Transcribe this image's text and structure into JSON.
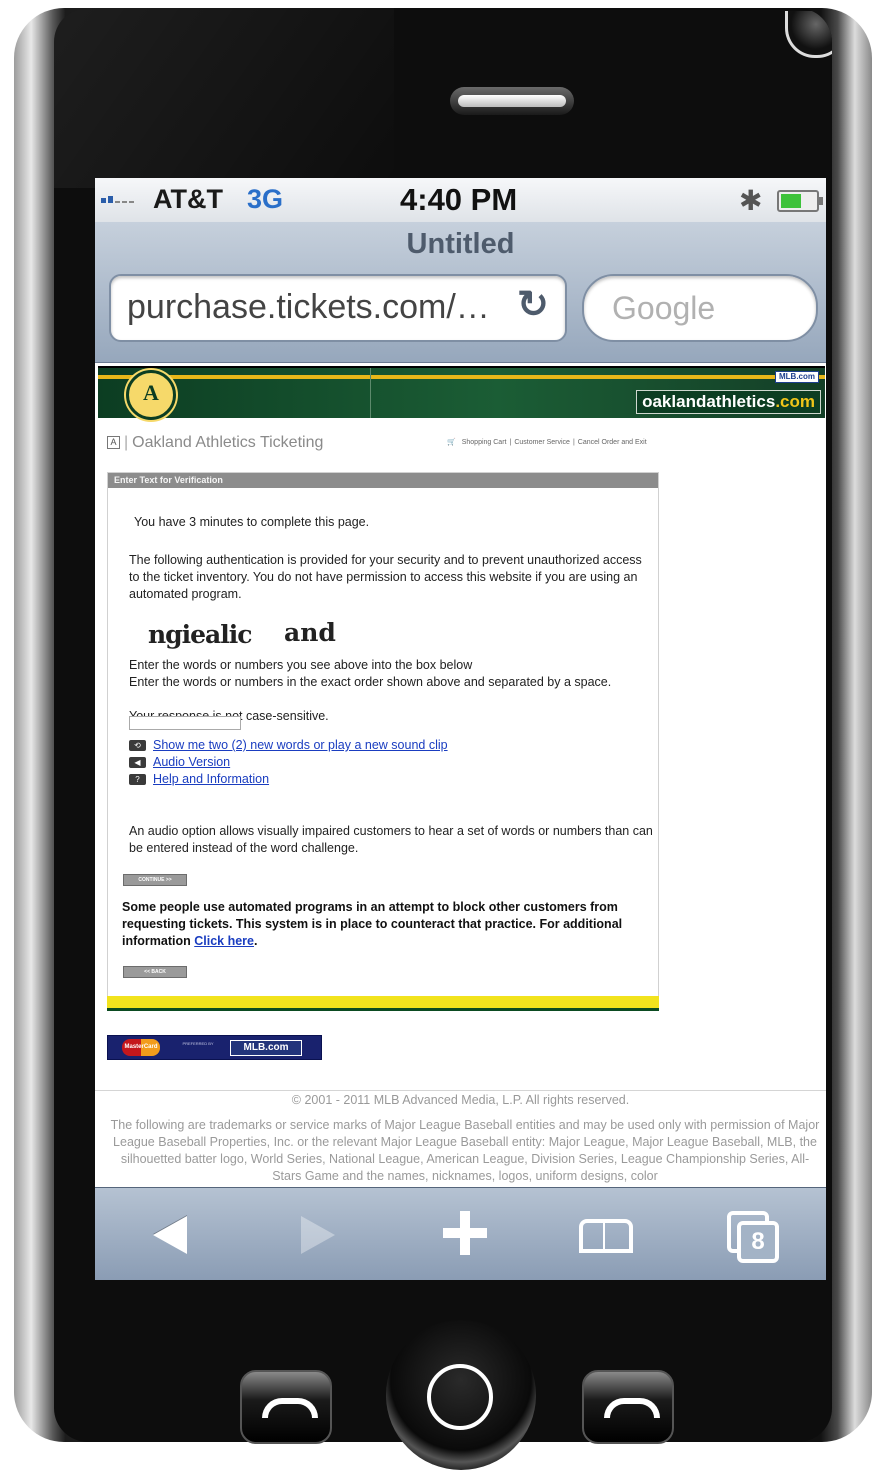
{
  "status_bar": {
    "carrier": "AT&T",
    "network": "3G",
    "time": "4:40 PM",
    "bluetooth_icon": "bluetooth-icon",
    "battery_level": 0.55
  },
  "browser": {
    "page_title": "Untitled",
    "url": "purchase.tickets.com/…",
    "search_placeholder": "Google",
    "tab_count": "8"
  },
  "site": {
    "banner_badge": "MLB.com",
    "domain_prefix": "oaklandathletics",
    "domain_suffix": ".com",
    "logo_letter": "A",
    "brand_title": "Oakland Athletics Ticketing",
    "top_links": [
      "Shopping Cart",
      "Customer Service",
      "Cancel Order and Exit"
    ]
  },
  "verification": {
    "header": "Enter Text for Verification",
    "timer_text": "You have 3 minutes to complete this page.",
    "intro": "The following authentication is provided for your security and to prevent unauthorized access to the ticket inventory. You do not have permission to access this website if you are using an automated program.",
    "captcha_word1": "ngiealic",
    "captcha_word2": "and",
    "instruction1": "Enter the words or numbers you see above into the box below",
    "instruction2": "Enter the words or numbers in the exact order shown above and separated by a space.",
    "instruction3": "Your response is not case-sensitive.",
    "links": [
      {
        "icon": "refresh-icon",
        "label": "Show me two (2) new words or play a new sound clip"
      },
      {
        "icon": "speaker-icon",
        "label": "Audio Version"
      },
      {
        "icon": "help-icon",
        "label": "Help and Information"
      }
    ],
    "audio_note": "An audio option allows visually impaired customers to hear a set of words or numbers than can be entered instead of the word challenge.",
    "continue_button": "CONTINUE >>",
    "bold_note": "Some people use automated programs in an attempt to block other customers from requesting tickets. This system is in place to counteract that practice. For additional information",
    "click_here": "Click here",
    "back_button": "<< BACK"
  },
  "preferred": {
    "card": "MasterCard",
    "preferred_by": "PREFERRED BY",
    "mlb_badge": "MLB.com"
  },
  "footer": {
    "copyright": "© 2001 - 2011 MLB Advanced Media, L.P. All rights reserved.",
    "legal": "The following are trademarks or service marks of Major League Baseball entities and may be used only with permission of Major League Baseball Properties, Inc. or the relevant Major League Baseball entity: Major League, Major League Baseball, MLB, the silhouetted batter logo, World Series, National League, American League, Division Series, League Championship Series, All-Stars Game and the names, nicknames, logos, uniform designs, color"
  },
  "toolbar": {
    "buttons": [
      "back-icon",
      "forward-icon",
      "add-icon",
      "bookmarks-icon",
      "pages-icon"
    ]
  },
  "colors": {
    "athletics_green": "#0c3d22",
    "athletics_gold": "#f0c419",
    "link_blue": "#1a3dc0",
    "safari_chrome": "#96a7bc"
  }
}
